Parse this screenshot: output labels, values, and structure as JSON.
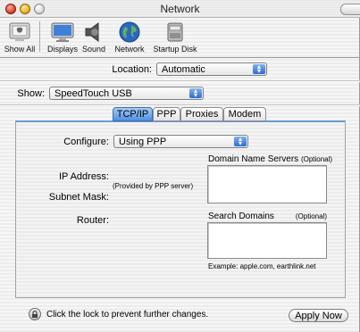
{
  "window": {
    "title": "Network"
  },
  "toolbar": {
    "items": [
      {
        "label": "Show All",
        "icon": "apple-icon"
      },
      {
        "label": "Displays",
        "icon": "display-icon"
      },
      {
        "label": "Sound",
        "icon": "speaker-icon"
      },
      {
        "label": "Network",
        "icon": "globe-icon"
      },
      {
        "label": "Startup Disk",
        "icon": "disk-icon"
      }
    ]
  },
  "location": {
    "label": "Location:",
    "value": "Automatic"
  },
  "show": {
    "label": "Show:",
    "value": "SpeedTouch USB"
  },
  "tabs": [
    {
      "label": "TCP/IP",
      "active": true
    },
    {
      "label": "PPP",
      "active": false
    },
    {
      "label": "Proxies",
      "active": false
    },
    {
      "label": "Modem",
      "active": false
    }
  ],
  "tcpip": {
    "configure_label": "Configure:",
    "configure_value": "Using PPP",
    "ip_label": "IP Address:",
    "ip_note": "(Provided by PPP server)",
    "subnet_label": "Subnet Mask:",
    "router_label": "Router:",
    "dns_label": "Domain Name Servers",
    "dns_optional": "(Optional)",
    "dns_value": "",
    "search_label": "Search Domains",
    "search_optional": "(Optional)",
    "search_value": "",
    "example": "Example: apple.com, earthlink.net"
  },
  "footer": {
    "lock_text": "Click the lock to prevent further changes.",
    "apply_label": "Apply Now"
  },
  "colors": {
    "accent": "#4f8fe0",
    "close": "#e0442e",
    "minimize": "#f2b11c"
  }
}
